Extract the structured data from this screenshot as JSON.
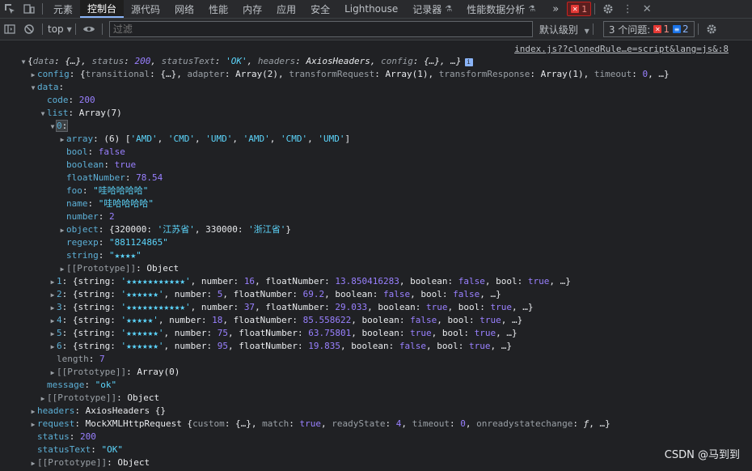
{
  "tabs": [
    {
      "label": "元素",
      "active": false
    },
    {
      "label": "控制台",
      "active": true
    },
    {
      "label": "源代码",
      "active": false
    },
    {
      "label": "网络",
      "active": false
    },
    {
      "label": "性能",
      "active": false
    },
    {
      "label": "内存",
      "active": false
    },
    {
      "label": "应用",
      "active": false
    },
    {
      "label": "安全",
      "active": false
    },
    {
      "label": "Lighthouse",
      "active": false
    },
    {
      "label": "记录器",
      "active": false,
      "flask": true
    },
    {
      "label": "性能数据分析",
      "active": false,
      "flask": true
    }
  ],
  "tabbar": {
    "error_count": "1",
    "more": "»"
  },
  "toolbar": {
    "context": "top",
    "filter_placeholder": "过滤",
    "level": "默认级别",
    "issues_label": "3 个问题:",
    "issues_err": "1",
    "issues_info": "2"
  },
  "source_link": "index.js??clonedRule…e=script&lang=js&:8",
  "watermark": "CSDN @马到到",
  "lines": [
    {
      "indent": 0,
      "tri": "down",
      "segs": [
        [
          "punc",
          "{"
        ],
        [
          "key-dim italic",
          "data"
        ],
        [
          "punc italic",
          ": {…}, "
        ],
        [
          "key-dim italic",
          "status"
        ],
        [
          "punc italic",
          ": "
        ],
        [
          "num italic",
          "200"
        ],
        [
          "punc italic",
          ", "
        ],
        [
          "key-dim italic",
          "statusText"
        ],
        [
          "punc italic",
          ": "
        ],
        [
          "str italic",
          "'OK'"
        ],
        [
          "punc italic",
          ", "
        ],
        [
          "key-dim italic",
          "headers"
        ],
        [
          "punc italic",
          ": AxiosHeaders, "
        ],
        [
          "key-dim italic",
          "config"
        ],
        [
          "punc italic",
          ": {…}, …}"
        ]
      ],
      "info": true
    },
    {
      "indent": 1,
      "tri": "right",
      "segs": [
        [
          "key",
          "config"
        ],
        [
          "punc",
          ": {"
        ],
        [
          "key-dim",
          "transitional"
        ],
        [
          "punc",
          ": {…}, "
        ],
        [
          "key-dim",
          "adapter"
        ],
        [
          "punc",
          ": Array(2), "
        ],
        [
          "key-dim",
          "transformRequest"
        ],
        [
          "punc",
          ": Array(1), "
        ],
        [
          "key-dim",
          "transformResponse"
        ],
        [
          "punc",
          ": Array(1), "
        ],
        [
          "key-dim",
          "timeout"
        ],
        [
          "punc",
          ": "
        ],
        [
          "num",
          "0"
        ],
        [
          "punc",
          ", …}"
        ]
      ]
    },
    {
      "indent": 1,
      "tri": "down",
      "segs": [
        [
          "key",
          "data"
        ],
        [
          "punc",
          ":"
        ]
      ]
    },
    {
      "indent": 2,
      "tri": "",
      "segs": [
        [
          "key",
          "code"
        ],
        [
          "punc",
          ": "
        ],
        [
          "num",
          "200"
        ]
      ]
    },
    {
      "indent": 2,
      "tri": "down",
      "segs": [
        [
          "key",
          "list"
        ],
        [
          "punc",
          ": Array(7)"
        ]
      ]
    },
    {
      "indent": 3,
      "tri": "down",
      "sel": true,
      "segs": [
        [
          "key",
          "0"
        ],
        [
          "punc",
          ":"
        ]
      ]
    },
    {
      "indent": 4,
      "tri": "right",
      "segs": [
        [
          "key",
          "array"
        ],
        [
          "punc",
          ": (6) ["
        ],
        [
          "str",
          "'AMD'"
        ],
        [
          "punc",
          ", "
        ],
        [
          "str",
          "'CMD'"
        ],
        [
          "punc",
          ", "
        ],
        [
          "str",
          "'UMD'"
        ],
        [
          "punc",
          ", "
        ],
        [
          "str",
          "'AMD'"
        ],
        [
          "punc",
          ", "
        ],
        [
          "str",
          "'CMD'"
        ],
        [
          "punc",
          ", "
        ],
        [
          "str",
          "'UMD'"
        ],
        [
          "punc",
          "]"
        ]
      ]
    },
    {
      "indent": 4,
      "tri": "",
      "segs": [
        [
          "key",
          "bool"
        ],
        [
          "punc",
          ": "
        ],
        [
          "bool",
          "false"
        ]
      ]
    },
    {
      "indent": 4,
      "tri": "",
      "segs": [
        [
          "key",
          "boolean"
        ],
        [
          "punc",
          ": "
        ],
        [
          "bool",
          "true"
        ]
      ]
    },
    {
      "indent": 4,
      "tri": "",
      "segs": [
        [
          "key",
          "floatNumber"
        ],
        [
          "punc",
          ": "
        ],
        [
          "num",
          "78.54"
        ]
      ]
    },
    {
      "indent": 4,
      "tri": "",
      "segs": [
        [
          "key",
          "foo"
        ],
        [
          "punc",
          ": "
        ],
        [
          "str",
          "\"哇哈哈哈哈\""
        ]
      ]
    },
    {
      "indent": 4,
      "tri": "",
      "segs": [
        [
          "key",
          "name"
        ],
        [
          "punc",
          ": "
        ],
        [
          "str",
          "\"哇哈哈哈哈\""
        ]
      ]
    },
    {
      "indent": 4,
      "tri": "",
      "segs": [
        [
          "key",
          "number"
        ],
        [
          "punc",
          ": "
        ],
        [
          "num",
          "2"
        ]
      ]
    },
    {
      "indent": 4,
      "tri": "right",
      "segs": [
        [
          "key",
          "object"
        ],
        [
          "punc",
          ": {320000: "
        ],
        [
          "str",
          "'江苏省'"
        ],
        [
          "punc",
          ", 330000: "
        ],
        [
          "str",
          "'浙江省'"
        ],
        [
          "punc",
          "}"
        ]
      ]
    },
    {
      "indent": 4,
      "tri": "",
      "segs": [
        [
          "key",
          "regexp"
        ],
        [
          "punc",
          ": "
        ],
        [
          "str",
          "\"881124865\""
        ]
      ]
    },
    {
      "indent": 4,
      "tri": "",
      "segs": [
        [
          "key",
          "string"
        ],
        [
          "punc",
          ": "
        ],
        [
          "str",
          "\"★★★★\""
        ]
      ]
    },
    {
      "indent": 4,
      "tri": "right",
      "segs": [
        [
          "key-dim",
          "[[Prototype]]"
        ],
        [
          "punc",
          ": Object"
        ]
      ]
    },
    {
      "indent": 3,
      "tri": "right",
      "segs": [
        [
          "key",
          "1"
        ],
        [
          "punc",
          ": {string: "
        ],
        [
          "str",
          "'★★★★★★★★★★★'"
        ],
        [
          "punc",
          ", number: "
        ],
        [
          "num",
          "16"
        ],
        [
          "punc",
          ", floatNumber: "
        ],
        [
          "num",
          "13.850416283"
        ],
        [
          "punc",
          ", boolean: "
        ],
        [
          "bool",
          "false"
        ],
        [
          "punc",
          ", bool: "
        ],
        [
          "bool",
          "true"
        ],
        [
          "punc",
          ", …}"
        ]
      ]
    },
    {
      "indent": 3,
      "tri": "right",
      "segs": [
        [
          "key",
          "2"
        ],
        [
          "punc",
          ": {string: "
        ],
        [
          "str",
          "'★★★★★★'"
        ],
        [
          "punc",
          ", number: "
        ],
        [
          "num",
          "5"
        ],
        [
          "punc",
          ", floatNumber: "
        ],
        [
          "num",
          "69.2"
        ],
        [
          "punc",
          ", boolean: "
        ],
        [
          "bool",
          "false"
        ],
        [
          "punc",
          ", bool: "
        ],
        [
          "bool",
          "false"
        ],
        [
          "punc",
          ", …}"
        ]
      ]
    },
    {
      "indent": 3,
      "tri": "right",
      "segs": [
        [
          "key",
          "3"
        ],
        [
          "punc",
          ": {string: "
        ],
        [
          "str",
          "'★★★★★★★★★★★'"
        ],
        [
          "punc",
          ", number: "
        ],
        [
          "num",
          "37"
        ],
        [
          "punc",
          ", floatNumber: "
        ],
        [
          "num",
          "29.033"
        ],
        [
          "punc",
          ", boolean: "
        ],
        [
          "bool",
          "true"
        ],
        [
          "punc",
          ", bool: "
        ],
        [
          "bool",
          "true"
        ],
        [
          "punc",
          ", …}"
        ]
      ]
    },
    {
      "indent": 3,
      "tri": "right",
      "segs": [
        [
          "key",
          "4"
        ],
        [
          "punc",
          ": {string: "
        ],
        [
          "str",
          "'★★★★★'"
        ],
        [
          "punc",
          ", number: "
        ],
        [
          "num",
          "18"
        ],
        [
          "punc",
          ", floatNumber: "
        ],
        [
          "num",
          "85.558622"
        ],
        [
          "punc",
          ", boolean: "
        ],
        [
          "bool",
          "false"
        ],
        [
          "punc",
          ", bool: "
        ],
        [
          "bool",
          "true"
        ],
        [
          "punc",
          ", …}"
        ]
      ]
    },
    {
      "indent": 3,
      "tri": "right",
      "segs": [
        [
          "key",
          "5"
        ],
        [
          "punc",
          ": {string: "
        ],
        [
          "str",
          "'★★★★★★'"
        ],
        [
          "punc",
          ", number: "
        ],
        [
          "num",
          "75"
        ],
        [
          "punc",
          ", floatNumber: "
        ],
        [
          "num",
          "63.75801"
        ],
        [
          "punc",
          ", boolean: "
        ],
        [
          "bool",
          "true"
        ],
        [
          "punc",
          ", bool: "
        ],
        [
          "bool",
          "true"
        ],
        [
          "punc",
          ", …}"
        ]
      ]
    },
    {
      "indent": 3,
      "tri": "right",
      "segs": [
        [
          "key",
          "6"
        ],
        [
          "punc",
          ": {string: "
        ],
        [
          "str",
          "'★★★★★★'"
        ],
        [
          "punc",
          ", number: "
        ],
        [
          "num",
          "95"
        ],
        [
          "punc",
          ", floatNumber: "
        ],
        [
          "num",
          "19.835"
        ],
        [
          "punc",
          ", boolean: "
        ],
        [
          "bool",
          "false"
        ],
        [
          "punc",
          ", bool: "
        ],
        [
          "bool",
          "true"
        ],
        [
          "punc",
          ", …}"
        ]
      ]
    },
    {
      "indent": 3,
      "tri": "",
      "segs": [
        [
          "key-dim",
          "length"
        ],
        [
          "punc",
          ": "
        ],
        [
          "num",
          "7"
        ]
      ]
    },
    {
      "indent": 3,
      "tri": "right",
      "segs": [
        [
          "key-dim",
          "[[Prototype]]"
        ],
        [
          "punc",
          ": Array(0)"
        ]
      ]
    },
    {
      "indent": 2,
      "tri": "",
      "segs": [
        [
          "key",
          "message"
        ],
        [
          "punc",
          ": "
        ],
        [
          "str",
          "\"ok\""
        ]
      ]
    },
    {
      "indent": 2,
      "tri": "right",
      "segs": [
        [
          "key-dim",
          "[[Prototype]]"
        ],
        [
          "punc",
          ": Object"
        ]
      ]
    },
    {
      "indent": 1,
      "tri": "right",
      "segs": [
        [
          "key",
          "headers"
        ],
        [
          "punc",
          ": AxiosHeaders {}"
        ]
      ]
    },
    {
      "indent": 1,
      "tri": "right",
      "segs": [
        [
          "key",
          "request"
        ],
        [
          "punc",
          ": MockXMLHttpRequest {"
        ],
        [
          "key-dim",
          "custom"
        ],
        [
          "punc",
          ": {…}, "
        ],
        [
          "key-dim",
          "match"
        ],
        [
          "punc",
          ": "
        ],
        [
          "bool",
          "true"
        ],
        [
          "punc",
          ", "
        ],
        [
          "key-dim",
          "readyState"
        ],
        [
          "punc",
          ": "
        ],
        [
          "num",
          "4"
        ],
        [
          "punc",
          ", "
        ],
        [
          "key-dim",
          "timeout"
        ],
        [
          "punc",
          ": "
        ],
        [
          "num",
          "0"
        ],
        [
          "punc",
          ", "
        ],
        [
          "key-dim",
          "onreadystatechange"
        ],
        [
          "punc",
          ": "
        ],
        [
          "plain italic",
          "ƒ"
        ],
        [
          "punc",
          ", …}"
        ]
      ]
    },
    {
      "indent": 1,
      "tri": "",
      "segs": [
        [
          "key",
          "status"
        ],
        [
          "punc",
          ": "
        ],
        [
          "num",
          "200"
        ]
      ]
    },
    {
      "indent": 1,
      "tri": "",
      "segs": [
        [
          "key",
          "statusText"
        ],
        [
          "punc",
          ": "
        ],
        [
          "str",
          "\"OK\""
        ]
      ]
    },
    {
      "indent": 1,
      "tri": "right",
      "segs": [
        [
          "key-dim",
          "[[Prototype]]"
        ],
        [
          "punc",
          ": Object"
        ]
      ]
    }
  ]
}
